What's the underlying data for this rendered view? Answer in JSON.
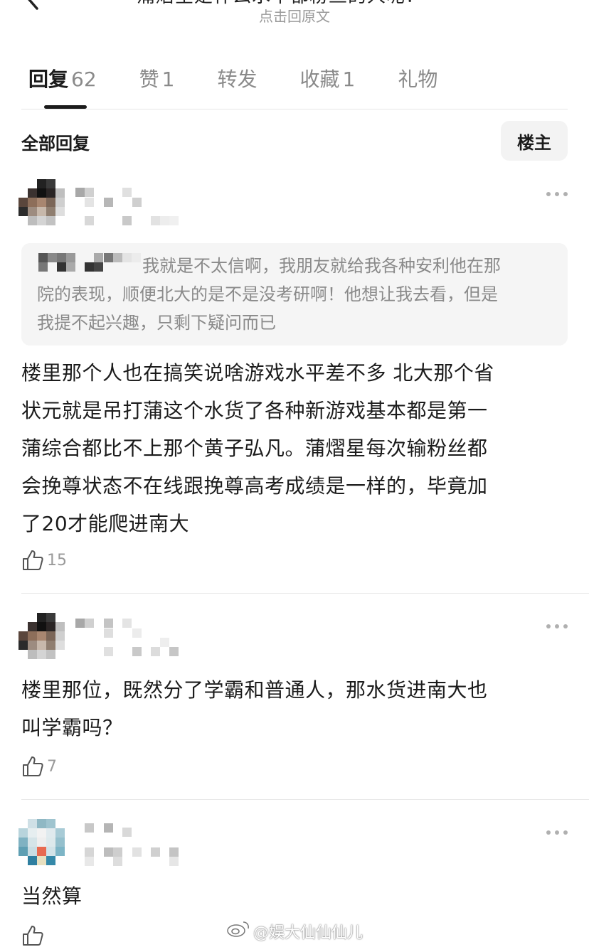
{
  "header": {
    "title": "蒲熠星是什么水平都粉丝的人呢？",
    "subtitle": "点击回原文"
  },
  "tabs": [
    {
      "label": "回复",
      "count": "62",
      "active": true
    },
    {
      "label": "赞",
      "count": "1",
      "active": false
    },
    {
      "label": "转发",
      "count": "",
      "active": false
    },
    {
      "label": "收藏",
      "count": "1",
      "active": false
    },
    {
      "label": "礼物",
      "count": "",
      "active": false
    }
  ],
  "filter": {
    "all_replies": "全部回复",
    "owner_button": "楼主"
  },
  "comments": [
    {
      "quote": "我就是不太信啊，我朋友就给我各种安利他在那院的表现，顺便北大的是不是没考研啊！他想让我去看，但是我提不起兴趣，只剩下疑问而已",
      "quote_line1": "我就是不太信啊，我朋友就给我各种安利他在那",
      "quote_line2": "院的表现，顺便北大的是不是没考研啊！他想让我去看，但是",
      "quote_line3": "我提不起兴趣，只剩下疑问而已",
      "lines": [
        "楼里那个人也在搞笑说啥游戏水平差不多 北大那个省",
        "状元就是吊打蒲这个水货了各种新游戏基本都是第一",
        "蒲综合都比不上那个黄子弘凡。蒲熠星每次输粉丝都",
        "会挽尊状态不在线跟挽尊高考成绩是一样的，毕竟加",
        "了20才能爬进南大"
      ],
      "likes": "15"
    },
    {
      "lines": [
        "楼里那位，既然分了学霸和普通人，那水货进南大也",
        "叫学霸吗？"
      ],
      "likes": "7"
    },
    {
      "lines": [
        "当然算"
      ],
      "likes": ""
    }
  ],
  "watermark": "@娱大仙仙仙儿",
  "icons": [
    "back-icon",
    "more-icon",
    "like-icon",
    "weibo-icon"
  ]
}
